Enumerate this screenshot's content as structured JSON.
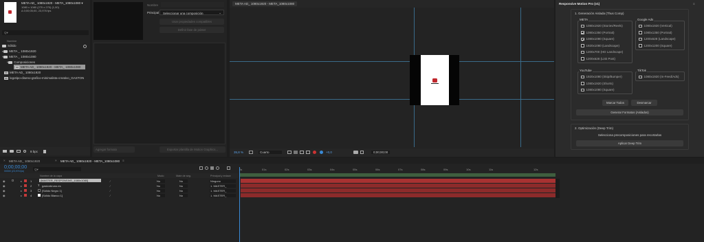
{
  "project": {
    "comp_name": "META AD_ 1080x1920 - META_1080x1080 ▾",
    "comp_size": "1080 x 1080 (270 x 270) (1,00)",
    "comp_duration": "Δ 0;00;05;00, 23,976 fps",
    "search_placeholder": "Q▾",
    "col_name": "Nombre",
    "items": [
      {
        "label": "Sólido",
        "type": "folder",
        "depth": 0
      },
      {
        "label": "META _ 1080x1920",
        "type": "folder",
        "depth": 0
      },
      {
        "label": "META _ 1080x1080",
        "type": "folder",
        "depth": 0
      },
      {
        "label": "Composiciones",
        "type": "folder",
        "depth": 1
      },
      {
        "label": "META AD_ 1080x1920 - META_ 1080x1080",
        "type": "comp",
        "depth": 2
      },
      {
        "label": "META AD_ 1080x1920",
        "type": "comp",
        "depth": 0
      },
      {
        "label": "logotipo-diseno-grafico-minimalista-creativo_GASTON",
        "type": "comp",
        "depth": 0
      }
    ],
    "bpc": "8 bpc"
  },
  "export_panel": {
    "nombre_label": "Nombre",
    "principal_label": "Principal",
    "select_value": "Seleccionar una composición",
    "btn_props": "Usar propiedades compatibles",
    "btn_pose": "Definir fase de póster",
    "footer_left": "Agregar formato",
    "footer_right": "Exportar plantilla de Motion Graphics..."
  },
  "viewer": {
    "tab": "META AD_ 1080x1920 - META_1080x1080",
    "zoom": "35,8 %",
    "quality": "Cuarto",
    "value": "+0,0",
    "timecode": "0;00;00;00"
  },
  "timeline": {
    "tabs": [
      "META AD_ 1080x1920",
      "META AD_ 1080x1920 - META_1080x1080"
    ],
    "timecode": "0;00;00;00",
    "frames": "00000 (23,976 fps)",
    "search_placeholder": "Q▾",
    "col_layer": "Nombre de la capa",
    "col_mode": "Modo",
    "col_mate": "Mate de seg.",
    "col_parent": "Principal y enlace",
    "ruler": [
      "0s",
      "01s",
      "02s",
      "03s",
      "04s",
      "05s",
      "06s",
      "07s",
      "08s",
      "09s",
      "10s",
      "11s",
      "12s"
    ],
    "layers": [
      {
        "num": "1",
        "name": "[MASTER_RESPONSIVE_1080x1080]",
        "mode": "No",
        "mate": "No",
        "parent": "Ninguno",
        "color": "#c33a3a"
      },
      {
        "num": "2",
        "name": "gastonbruno.es",
        "mode": "No",
        "mate": "No",
        "parent": "1. MASTER_",
        "color": "#c33a3a"
      },
      {
        "num": "3",
        "name": "[Sólido Negro 1]",
        "mode": "No",
        "mate": "No",
        "parent": "1. MASTER_",
        "color": "#c33a3a"
      },
      {
        "num": "4",
        "name": "[Sólido Blanco 1]",
        "mode": "No",
        "mate": "No",
        "parent": "1. MASTER_",
        "color": "#c33a3a"
      }
    ]
  },
  "plugin": {
    "title": "Responsive Motion Pro (v1)",
    "section1": "1. Generación Aislada (Thus Comp)",
    "meta_title": "META",
    "meta_opts": [
      {
        "label": "1080x1920 (Stories/Reels)",
        "checked": false
      },
      {
        "label": "1080x1350 (Portrait)",
        "checked": true
      },
      {
        "label": "1080x1080 (Square)",
        "checked": true
      },
      {
        "label": "1920x1080 (Landscape)",
        "checked": false
      },
      {
        "label": "1200x700 (HD Landscape)",
        "checked": false
      },
      {
        "label": "1200x628 (Link Post)",
        "checked": false
      }
    ],
    "google_title": "Google Ads",
    "google_opts": [
      {
        "label": "1080x1920 (Vertical)",
        "checked": false
      },
      {
        "label": "1080x1350 (Portrait)",
        "checked": false
      },
      {
        "label": "1200x628 (Landscape)",
        "checked": false
      },
      {
        "label": "1200x1200 (Square)",
        "checked": false
      }
    ],
    "youtube_title": "YouTube",
    "youtube_opts": [
      {
        "label": "1920x1080 (Skip/Bumper)",
        "checked": false
      },
      {
        "label": "1080x1920 (Shorts)",
        "checked": false
      },
      {
        "label": "1080x1080 (Square)",
        "checked": false
      }
    ],
    "tiktok_title": "TikTok",
    "tiktok_opts": [
      {
        "label": "1080x1920 (In-Feed/Ads)",
        "checked": false
      }
    ],
    "btn_all": "Marcar Todos",
    "btn_none": "Desmarcar",
    "btn_generate": "Generar Formatos (Aislados)",
    "section2": "2. Optimización (Deep Trim)",
    "hint": "Selecciona precomposiciones para recortarlas",
    "btn_trim": "Aplicar Deep Trim"
  }
}
